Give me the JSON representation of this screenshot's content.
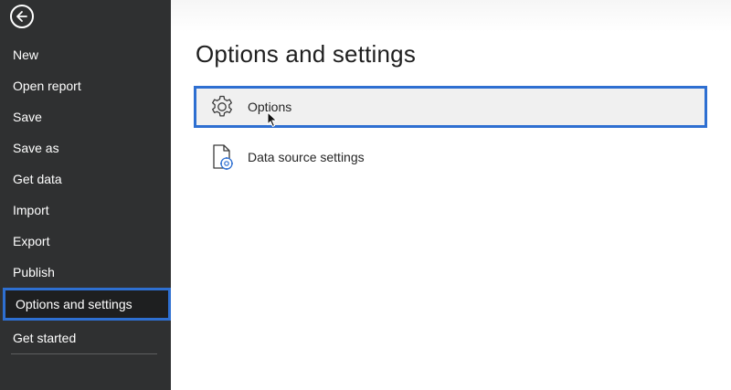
{
  "sidebar": {
    "back_icon": "back-arrow-icon",
    "items": [
      {
        "label": "New"
      },
      {
        "label": "Open report"
      },
      {
        "label": "Save"
      },
      {
        "label": "Save as"
      },
      {
        "label": "Get data"
      },
      {
        "label": "Import"
      },
      {
        "label": "Export"
      },
      {
        "label": "Publish"
      },
      {
        "label": "Options and settings",
        "selected": true
      },
      {
        "label": "Get started"
      }
    ]
  },
  "main": {
    "title": "Options and settings",
    "options": [
      {
        "label": "Options",
        "icon": "gear-icon",
        "selected": true
      },
      {
        "label": "Data source settings",
        "icon": "data-source-settings-icon"
      }
    ]
  },
  "colors": {
    "sidebar_bg": "#2f3031",
    "highlight_border": "#2e6fd1",
    "selected_row_bg": "#f0f0f0"
  }
}
